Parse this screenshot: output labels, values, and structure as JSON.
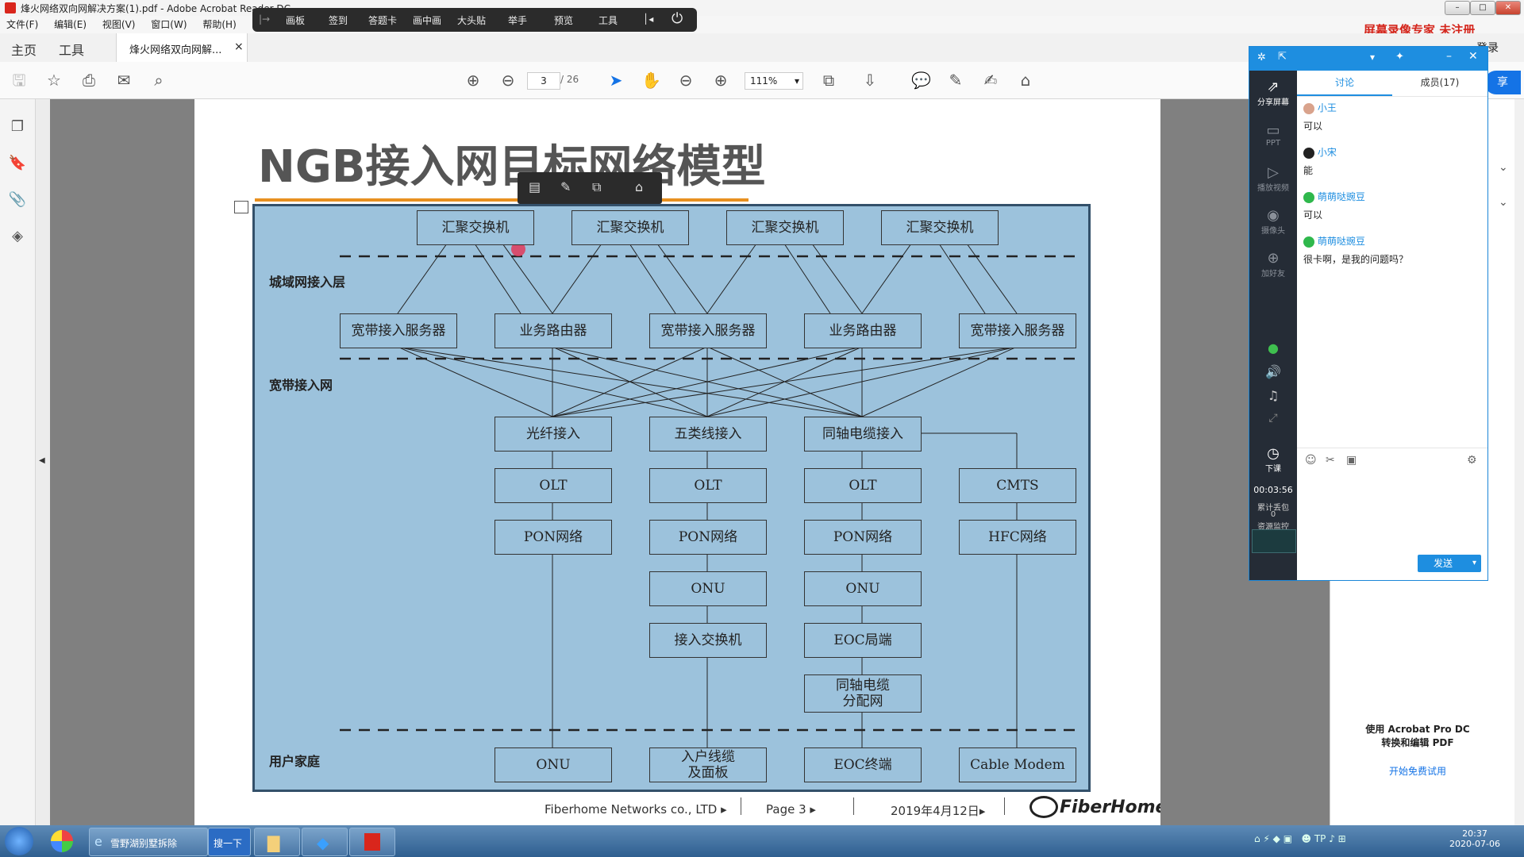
{
  "window": {
    "title": "烽火网络双向网解决方案(1).pdf - Adobe Acrobat Reader DC",
    "menu": [
      "文件(F)",
      "编辑(E)",
      "视图(V)",
      "窗口(W)",
      "帮助(H)"
    ]
  },
  "meeting_toolbar": {
    "items": [
      "画板",
      "签到",
      "答题卡",
      "画中画",
      "大头贴",
      "举手",
      "预览",
      "工具"
    ]
  },
  "watermark": "屏幕录像专家  未注册",
  "tabs": {
    "home": "主页",
    "tools": "工具",
    "doc_tab": "烽火网络双向网解...",
    "close": "×",
    "login": "登录"
  },
  "toolbar": {
    "page_current": "3",
    "page_sep": "/",
    "page_total": "26",
    "zoom": "111%"
  },
  "slide": {
    "title": "NGB接入网目标网络模型",
    "layers": [
      "城域网接入层",
      "宽带接入网",
      "用户家庭"
    ],
    "row1": [
      "汇聚交换机",
      "汇聚交换机",
      "汇聚交换机",
      "汇聚交换机"
    ],
    "row2": [
      "宽带接入服务器",
      "业务路由器",
      "宽带接入服务器",
      "业务路由器",
      "宽带接入服务器"
    ],
    "row3": [
      "光纤接入",
      "五类线接入",
      "同轴电缆接入"
    ],
    "col1": [
      "OLT",
      "PON网络"
    ],
    "col2": [
      "OLT",
      "PON网络",
      "ONU",
      "接入交换机"
    ],
    "col3": [
      "OLT",
      "PON网络",
      "ONU",
      "EOC局端",
      "同轴电缆\n分配网"
    ],
    "col4": [
      "CMTS",
      "HFC网络"
    ],
    "bottom": [
      "ONU",
      "入户线缆\n及面板",
      "EOC终端",
      "Cable Modem"
    ],
    "footer": {
      "company": "Fiberhome Networks co., LTD",
      "page": "Page  3",
      "date": "2019年4月12日",
      "logo": "FiberHome"
    }
  },
  "chat": {
    "tabs": [
      "讨论",
      "成员(17)"
    ],
    "side": [
      "分享屏幕",
      "PPT",
      "播放视频",
      "摄像头",
      "加好友"
    ],
    "messages": [
      {
        "name": "小王",
        "text": "可以"
      },
      {
        "name": "小宋",
        "text": "能"
      },
      {
        "name": "萌萌哒豌豆",
        "text": "可以"
      },
      {
        "name": "萌萌哒豌豆",
        "text": "很卡啊，是我的问题吗？"
      }
    ],
    "end_class": "下课",
    "timer": "00:03:56",
    "stats1": "累计丢包",
    "stats2": "0",
    "stats3": "资源监控",
    "send": "发送"
  },
  "right_pane": {
    "promo": "使用 Acrobat Pro DC\n转换和编辑 PDF",
    "trial": "开始免费试用",
    "share": "享"
  },
  "taskbar": {
    "items": [
      "雪野湖别墅拆除",
      "搜一下"
    ],
    "time": "20:37",
    "date": "2020-07-06"
  }
}
